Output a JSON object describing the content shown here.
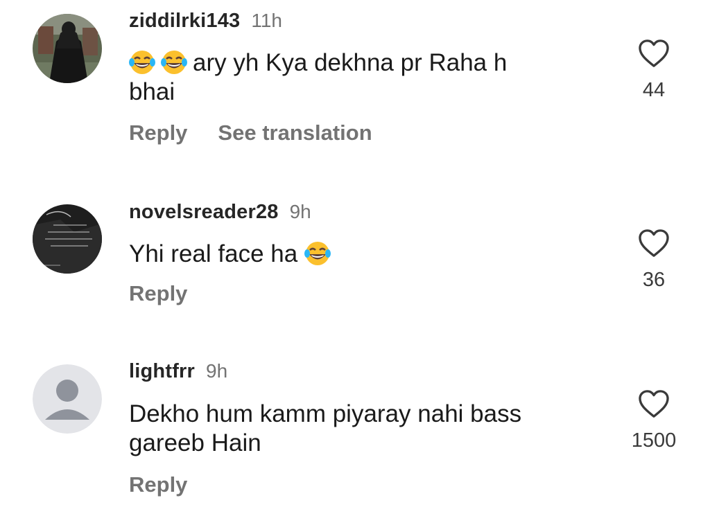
{
  "comments": [
    {
      "username": "ziddilrki143",
      "time": "11h",
      "emoji_prefix": [
        "face-with-tears-of-joy",
        "face-with-tears-of-joy"
      ],
      "text_line1": "ary yh Kya dekhna pr Raha h",
      "text_line2": "bhai",
      "actions": [
        "Reply",
        "See translation"
      ],
      "likes": "44"
    },
    {
      "username": "novelsreader28",
      "time": "9h",
      "text_line1": "Yhi real face ha",
      "emoji_suffix": [
        "face-with-tears-of-joy"
      ],
      "actions": [
        "Reply"
      ],
      "likes": "36"
    },
    {
      "username": "lightfrr",
      "time": "9h",
      "text_line1": "Dekho hum kamm piyaray nahi bass",
      "text_line2": "gareeb Hain",
      "actions": [
        "Reply"
      ],
      "likes": "1500"
    }
  ],
  "colors": {
    "username": "#262626",
    "muted": "#737373",
    "default_avatar_bg": "#dbdbdb",
    "default_avatar_fg": "#8e8e8e"
  },
  "icons": {
    "like": "heart-outline-icon",
    "default_avatar": "default-avatar-icon"
  }
}
